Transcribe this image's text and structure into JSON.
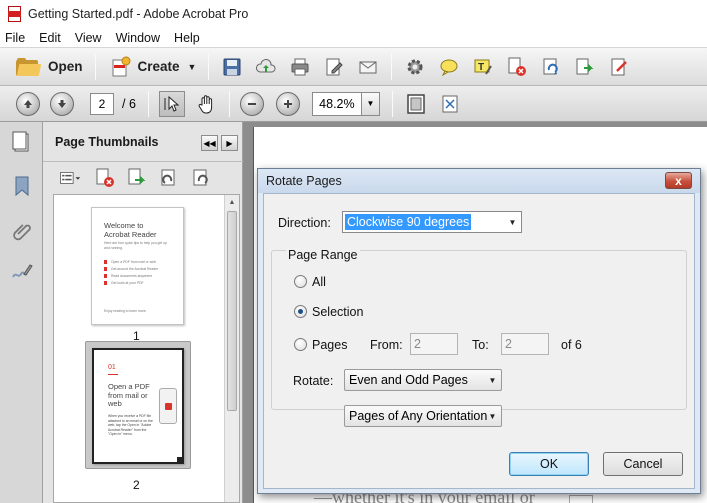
{
  "window": {
    "title": "Getting Started.pdf - Adobe Acrobat Pro"
  },
  "menu": [
    "File",
    "Edit",
    "View",
    "Window",
    "Help"
  ],
  "toolbar": {
    "open_label": "Open",
    "create_label": "Create",
    "tools": [
      "save-icon",
      "cloud-upload-icon",
      "print-icon",
      "edit-icon",
      "email-icon",
      "settings-icon",
      "comment-icon",
      "highlight-icon",
      "delete-pages-icon",
      "rotate-icon",
      "extract-icon",
      "sign-icon"
    ]
  },
  "nav": {
    "current_page": "2",
    "total_pages": "/ 6",
    "zoom": "48.2%"
  },
  "thumbnails": {
    "title": "Page Thumbnails",
    "pages": [
      {
        "number": "1",
        "heading_line1": "Welcome to",
        "heading_line2": "Acrobat Reader",
        "sub": "Here are four quick tips to help you get up and running.",
        "items": [
          "Open a PDF from mail or web",
          "Get around the Acrobat Reader",
          "Read documents anywhere",
          "Get tools at your PDF"
        ],
        "footer": "Enjoy reading to learn more."
      },
      {
        "number": "2",
        "step": "01",
        "heading": "Open a PDF from mail or web",
        "body": "When you receive a PDF file attached to an email or on the web, tap the Open in \"Adobe Acrobat Reader\" from the \"Open in\" menu."
      }
    ]
  },
  "document": {
    "visible_text": "—whether it's in your email or"
  },
  "dialog": {
    "title": "Rotate Pages",
    "close_label": "x",
    "direction_label": "Direction:",
    "direction_value": "Clockwise 90 degrees",
    "page_range_label": "Page Range",
    "radio_all": "All",
    "radio_selection": "Selection",
    "radio_pages": "Pages",
    "from_label": "From:",
    "from_value": "2",
    "to_label": "To:",
    "to_value": "2",
    "of_label": "of 6",
    "rotate_label": "Rotate:",
    "rotate_value": "Even and Odd Pages",
    "orientation_value": "Pages of Any Orientation",
    "ok_label": "OK",
    "cancel_label": "Cancel"
  }
}
